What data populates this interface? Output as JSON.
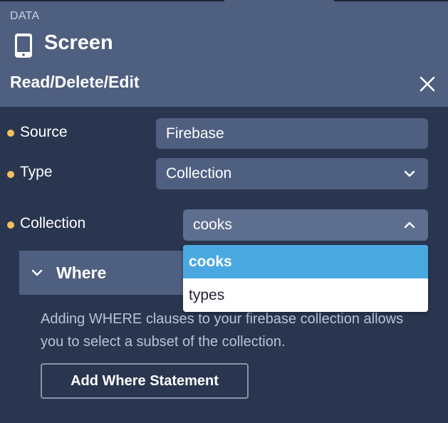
{
  "header": {
    "section_label": "DATA",
    "title": "Screen",
    "subtitle": "Read/Delete/Edit"
  },
  "form": {
    "source": {
      "label": "Source",
      "value": "Firebase"
    },
    "type": {
      "label": "Type",
      "value": "Collection"
    },
    "collection": {
      "label": "Collection",
      "value": "cooks"
    }
  },
  "dropdown": {
    "options": [
      {
        "label": "cooks",
        "selected": true
      },
      {
        "label": "types",
        "selected": false
      }
    ]
  },
  "where": {
    "title": "Where",
    "description": "Adding WHERE clauses to your firebase collection allows you to select a subset of the collection.",
    "add_button_label": "Add Where Statement"
  },
  "icons": {
    "phone": "phone-icon",
    "close": "close-icon",
    "chevron_down": "chevron-down-icon",
    "chevron_up": "chevron-up-icon"
  },
  "colors": {
    "background": "#2a3650",
    "panel": "#4f5f80",
    "required_dot": "#f2bf5c",
    "dropdown_selected": "#4aa8e1"
  }
}
